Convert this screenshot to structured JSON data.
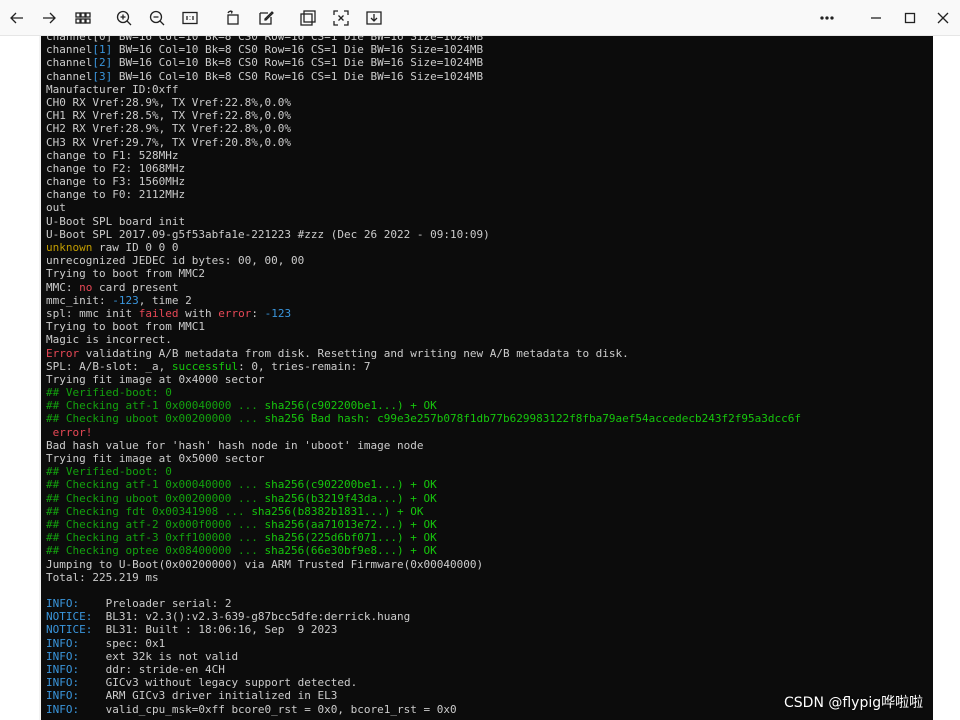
{
  "toolbar": {
    "buttons": [
      {
        "name": "back-button",
        "icon": "arrow-left-icon"
      },
      {
        "name": "forward-button",
        "icon": "arrow-right-icon"
      },
      {
        "name": "thumbnails-button",
        "icon": "grid-icon"
      },
      {
        "name": "zoom-in-button",
        "icon": "zoom-in-icon"
      },
      {
        "name": "zoom-out-button",
        "icon": "zoom-out-icon"
      },
      {
        "name": "actual-size-button",
        "icon": "actual-size-icon"
      },
      {
        "name": "rotate-button",
        "icon": "rotate-icon"
      },
      {
        "name": "edit-button",
        "icon": "edit-icon"
      },
      {
        "name": "crop-button",
        "icon": "crop-icon"
      },
      {
        "name": "fit-button",
        "icon": "fit-icon"
      },
      {
        "name": "save-button",
        "icon": "download-icon"
      },
      {
        "name": "more-button",
        "icon": "more-icon"
      },
      {
        "name": "minimize-button",
        "icon": "minimize-icon"
      },
      {
        "name": "maximize-button",
        "icon": "maximize-icon"
      },
      {
        "name": "close-button",
        "icon": "close-icon"
      }
    ]
  },
  "console": {
    "lines": [
      [
        {
          "t": "channel[0] BW=16 Col=10 Bk=8 CS0 Row=16 CS=1 Die BW=16 Size=1024MB",
          "c": "w"
        }
      ],
      [
        {
          "t": "channel",
          "c": "w"
        },
        {
          "t": "[1]",
          "c": "b"
        },
        {
          "t": " BW=16 Col=10 Bk=8 CS0 Row=16 CS=1 Die BW=16 Size=1024MB",
          "c": "w"
        }
      ],
      [
        {
          "t": "channel",
          "c": "w"
        },
        {
          "t": "[2]",
          "c": "b"
        },
        {
          "t": " BW=16 Col=10 Bk=8 CS0 Row=16 CS=1 Die BW=16 Size=1024MB",
          "c": "w"
        }
      ],
      [
        {
          "t": "channel",
          "c": "w"
        },
        {
          "t": "[3]",
          "c": "b"
        },
        {
          "t": " BW=16 Col=10 Bk=8 CS0 Row=16 CS=1 Die BW=16 Size=1024MB",
          "c": "w"
        }
      ],
      [
        {
          "t": "Manufacturer ID:0xff",
          "c": "w"
        }
      ],
      [
        {
          "t": "CH0 RX Vref:28.9%, TX Vref:22.8%,0.0%",
          "c": "w"
        }
      ],
      [
        {
          "t": "CH1 RX Vref:28.5%, TX Vref:22.8%,0.0%",
          "c": "w"
        }
      ],
      [
        {
          "t": "CH2 RX Vref:28.9%, TX Vref:22.8%,0.0%",
          "c": "w"
        }
      ],
      [
        {
          "t": "CH3 RX Vref:29.7%, TX Vref:20.8%,0.0%",
          "c": "w"
        }
      ],
      [
        {
          "t": "change to F1: 528MHz",
          "c": "w"
        }
      ],
      [
        {
          "t": "change to F2: 1068MHz",
          "c": "w"
        }
      ],
      [
        {
          "t": "change to F3: 1560MHz",
          "c": "w"
        }
      ],
      [
        {
          "t": "change to F0: 2112MHz",
          "c": "w"
        }
      ],
      [
        {
          "t": "out",
          "c": "w"
        }
      ],
      [
        {
          "t": "U-Boot SPL board init",
          "c": "w"
        }
      ],
      [
        {
          "t": "U-Boot SPL 2017.09-g5f53abfa1e-221223 #zzz (Dec 26 2022 - 09:10:09)",
          "c": "w"
        }
      ],
      [
        {
          "t": "unknown",
          "c": "y"
        },
        {
          "t": " raw ID 0 0 0",
          "c": "w"
        }
      ],
      [
        {
          "t": "unrecognized JEDEC id bytes: 00, 00, 00",
          "c": "w"
        }
      ],
      [
        {
          "t": "Trying to boot from MMC2",
          "c": "w"
        }
      ],
      [
        {
          "t": "MMC: ",
          "c": "w"
        },
        {
          "t": "no",
          "c": "r"
        },
        {
          "t": " card present",
          "c": "w"
        }
      ],
      [
        {
          "t": "mmc_init: ",
          "c": "w"
        },
        {
          "t": "-123",
          "c": "b"
        },
        {
          "t": ", time 2",
          "c": "w"
        }
      ],
      [
        {
          "t": "spl: mmc init ",
          "c": "w"
        },
        {
          "t": "failed",
          "c": "r"
        },
        {
          "t": " with ",
          "c": "w"
        },
        {
          "t": "error",
          "c": "r"
        },
        {
          "t": ": ",
          "c": "w"
        },
        {
          "t": "-123",
          "c": "b"
        }
      ],
      [
        {
          "t": "Trying to boot from MMC1",
          "c": "w"
        }
      ],
      [
        {
          "t": "Magic is incorrect.",
          "c": "w"
        }
      ],
      [
        {
          "t": "Error",
          "c": "r"
        },
        {
          "t": " validating A/B metadata from disk. Resetting and writing new A/B metadata to disk.",
          "c": "w"
        }
      ],
      [
        {
          "t": "SPL: A/B-slot: _a, ",
          "c": "w"
        },
        {
          "t": "successful",
          "c": "lg"
        },
        {
          "t": ": 0, tries-remain: 7",
          "c": "w"
        }
      ],
      [
        {
          "t": "Trying fit image at 0x4000 sector",
          "c": "w"
        }
      ],
      [
        {
          "t": "## Verified-boot: 0",
          "c": "g"
        }
      ],
      [
        {
          "t": "## Checking atf-1 0x00040000 ... ",
          "c": "g"
        },
        {
          "t": "sha256(c902200be1...) + OK",
          "c": "lg"
        }
      ],
      [
        {
          "t": "## Checking uboot 0x00200000 ... ",
          "c": "g"
        },
        {
          "t": "sha256 Bad hash: c99e3e257b078f1db77b629983122f8fba79aef54accedecb243f2f95a3dcc6f",
          "c": "lg"
        }
      ],
      [
        {
          "t": " error!",
          "c": "r"
        }
      ],
      [
        {
          "t": "Bad hash value for 'hash' hash node in 'uboot' image node",
          "c": "w"
        }
      ],
      [
        {
          "t": "Trying fit image at 0x5000 sector",
          "c": "w"
        }
      ],
      [
        {
          "t": "## Verified-boot: 0",
          "c": "g"
        }
      ],
      [
        {
          "t": "## Checking atf-1 0x00040000 ... ",
          "c": "g"
        },
        {
          "t": "sha256(c902200be1...) + OK",
          "c": "lg"
        }
      ],
      [
        {
          "t": "## Checking uboot 0x00200000 ... ",
          "c": "g"
        },
        {
          "t": "sha256(b3219f43da...) + OK",
          "c": "lg"
        }
      ],
      [
        {
          "t": "## Checking fdt 0x00341908 ... ",
          "c": "g"
        },
        {
          "t": "sha256(b8382b1831...) + OK",
          "c": "lg"
        }
      ],
      [
        {
          "t": "## Checking atf-2 0x000f0000 ... ",
          "c": "g"
        },
        {
          "t": "sha256(aa71013e72...) + OK",
          "c": "lg"
        }
      ],
      [
        {
          "t": "## Checking atf-3 0xff100000 ... ",
          "c": "g"
        },
        {
          "t": "sha256(225d6bf071...) + OK",
          "c": "lg"
        }
      ],
      [
        {
          "t": "## Checking optee 0x08400000 ... ",
          "c": "g"
        },
        {
          "t": "sha256(66e30bf9e8...) + OK",
          "c": "lg"
        }
      ],
      [
        {
          "t": "Jumping to U-Boot(0x00200000) via ARM Trusted Firmware(0x00040000)",
          "c": "w"
        }
      ],
      [
        {
          "t": "Total: 225.219 ms",
          "c": "w"
        }
      ],
      [
        {
          "t": "",
          "c": "w"
        }
      ],
      [
        {
          "t": "INFO:    ",
          "c": "b"
        },
        {
          "t": "Preloader serial: 2",
          "c": "w"
        }
      ],
      [
        {
          "t": "NOTICE:  ",
          "c": "b"
        },
        {
          "t": "BL31: v2.3():v2.3-639-g87bcc5dfe:derrick.huang",
          "c": "w"
        }
      ],
      [
        {
          "t": "NOTICE:  ",
          "c": "b"
        },
        {
          "t": "BL31: Built : 18:06:16, Sep  9 2023",
          "c": "w"
        }
      ],
      [
        {
          "t": "INFO:    ",
          "c": "b"
        },
        {
          "t": "spec: 0x1",
          "c": "w"
        }
      ],
      [
        {
          "t": "INFO:    ",
          "c": "b"
        },
        {
          "t": "ext 32k is not valid",
          "c": "w"
        }
      ],
      [
        {
          "t": "INFO:    ",
          "c": "b"
        },
        {
          "t": "ddr: stride-en 4CH",
          "c": "w"
        }
      ],
      [
        {
          "t": "INFO:    ",
          "c": "b"
        },
        {
          "t": "GICv3 without legacy support detected.",
          "c": "w"
        }
      ],
      [
        {
          "t": "INFO:    ",
          "c": "b"
        },
        {
          "t": "ARM GICv3 driver initialized in EL3",
          "c": "w"
        }
      ],
      [
        {
          "t": "INFO:    ",
          "c": "b"
        },
        {
          "t": "valid_cpu_msk=0xff bcore0_rst = 0x0, bcore1_rst = 0x0",
          "c": "w"
        }
      ]
    ]
  },
  "watermark": "CSDN @flypig哗啦啦"
}
